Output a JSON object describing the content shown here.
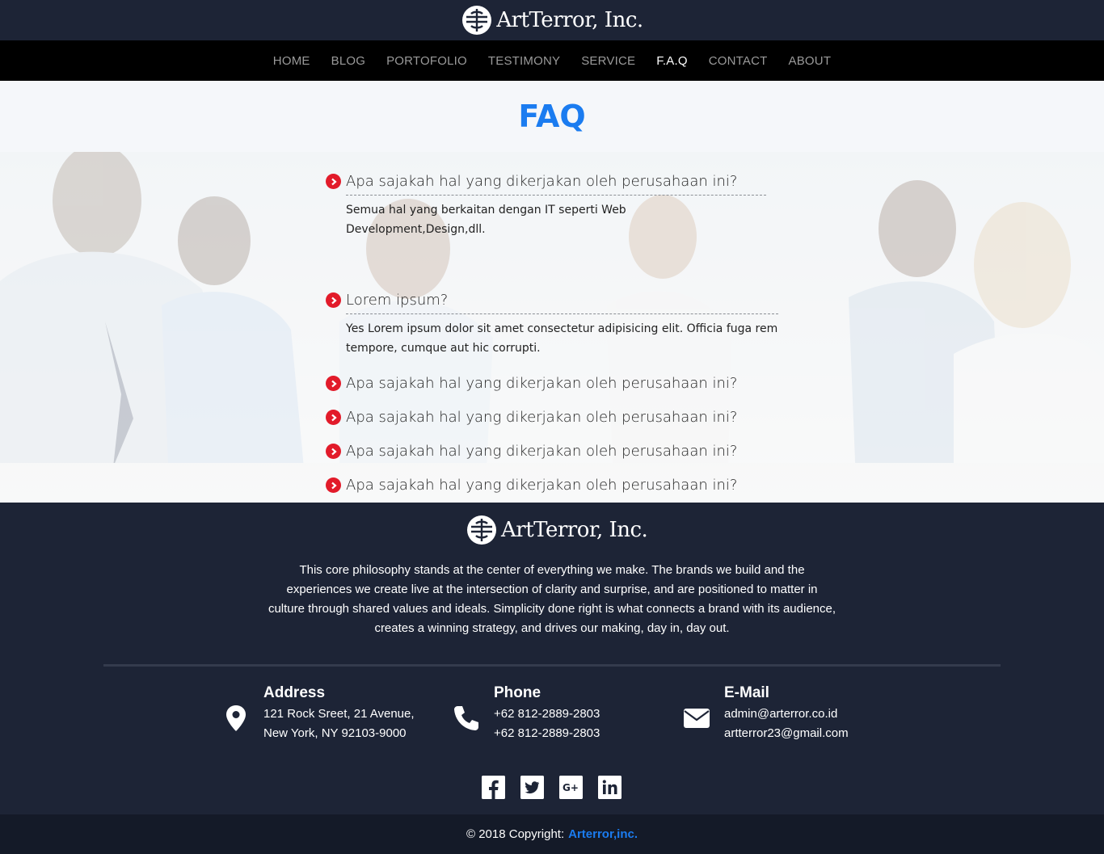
{
  "brand": {
    "name": "ArtTerror, Inc."
  },
  "nav": {
    "items": [
      {
        "label": "HOME"
      },
      {
        "label": "BLOG"
      },
      {
        "label": "PORTOFOLIO"
      },
      {
        "label": "TESTIMONY"
      },
      {
        "label": "SERVICE"
      },
      {
        "label": "F.A.Q"
      },
      {
        "label": "CONTACT"
      },
      {
        "label": "ABOUT"
      }
    ],
    "active": "F.A.Q"
  },
  "page_title": "FAQ",
  "faq": {
    "items": [
      {
        "question": "Apa sajakah hal yang dikerjakan oleh perusahaan ini?",
        "answer": "Semua hal yang berkaitan dengan IT seperti Web Development,Design,dll."
      },
      {
        "question": "Lorem ipsum?",
        "answer": "Yes Lorem ipsum dolor sit amet consectetur adipisicing elit. Officia fuga rem tempore, cumque aut hic corrupti."
      },
      {
        "question": "Apa sajakah hal yang dikerjakan oleh perusahaan ini?"
      },
      {
        "question": "Apa sajakah hal yang dikerjakan oleh perusahaan ini?"
      },
      {
        "question": "Apa sajakah hal yang dikerjakan oleh perusahaan ini?"
      },
      {
        "question": "Apa sajakah hal yang dikerjakan oleh perusahaan ini?"
      }
    ]
  },
  "footer": {
    "description": "This core philosophy stands at the center of everything we make. The brands we build and the experiences we create live at the intersection of clarity and surprise, and are positioned to matter in culture through shared values and ideals. Simplicity done right is what connects a brand with its audience, creates a winning strategy, and drives our making, day in, day out.",
    "address": {
      "title": "Address",
      "line1": "121 Rock Sreet, 21 Avenue,",
      "line2": "New York, NY 92103-9000",
      "icon": "map-marker-icon"
    },
    "phone": {
      "title": "Phone",
      "line1": "+62 812-2889-2803",
      "line2": "+62 812-2889-2803",
      "icon": "phone-icon"
    },
    "email": {
      "title": "E-Mail",
      "line1": "admin@arterror.co.id",
      "line2": "artterror23@gmail.com",
      "icon": "envelope-icon"
    },
    "socials": [
      "facebook-icon",
      "twitter-icon",
      "google-plus-icon",
      "linkedin-icon"
    ],
    "copyright_prefix": "© 2018 Copyright:",
    "copyright_brand": "Arterror,inc."
  },
  "colors": {
    "accent": "#1b7cf0",
    "bullet": "#e21b2a",
    "footer_bg": "#1d2436",
    "nav_bg": "#000000"
  }
}
